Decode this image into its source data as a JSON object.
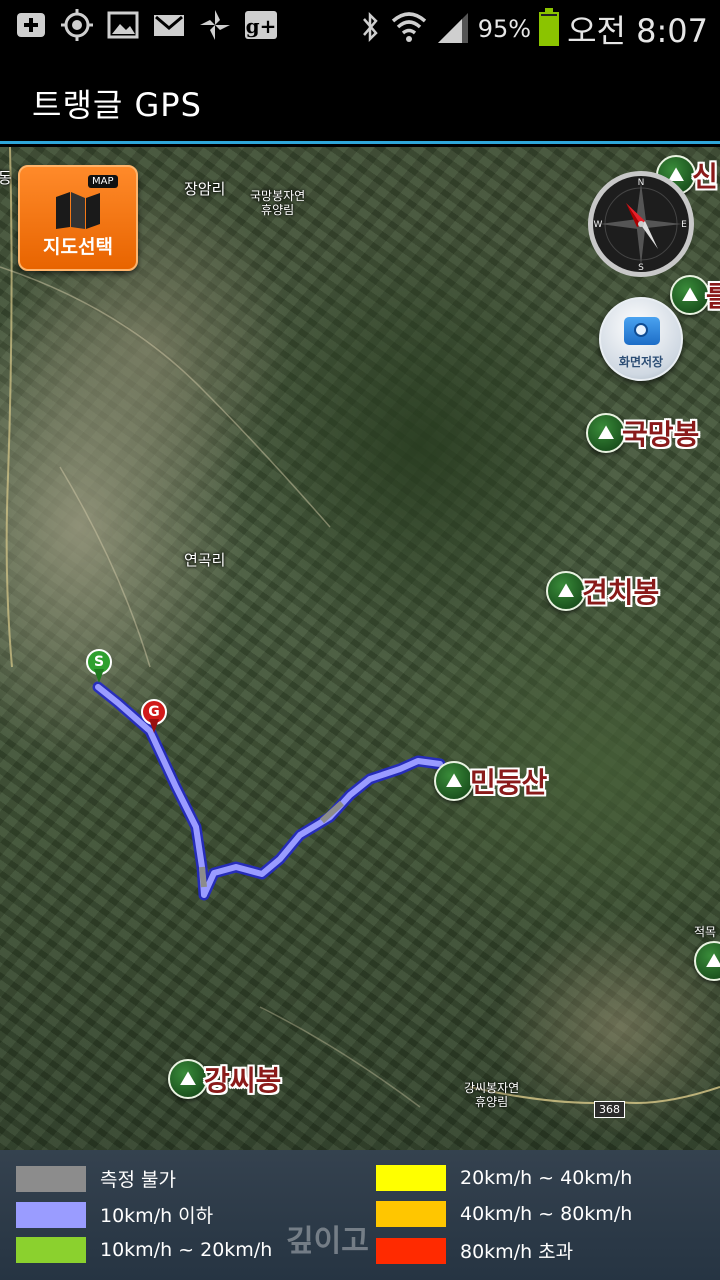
{
  "status_bar": {
    "icons": [
      "add-box-icon",
      "gps-icon",
      "picture-icon",
      "gmail-icon",
      "pinwheel-icon",
      "google-plus-icon"
    ],
    "battery_percent": "95%",
    "battery_level": 0.95,
    "time": "오전 8:07"
  },
  "app_bar": {
    "title": "트랭글 GPS"
  },
  "map": {
    "buttons": {
      "map_select": "지도선택",
      "map_badge": "MAP",
      "screenshot": "화면저장"
    },
    "compass": {
      "n": "N",
      "s": "S",
      "e": "E",
      "w": "W"
    },
    "place_labels": [
      {
        "name": "장암리"
      },
      {
        "name": "국망봉자연\n휴양림"
      },
      {
        "name": "연곡리"
      },
      {
        "name": "강씨봉자연\n휴양림"
      },
      {
        "name": "동"
      }
    ],
    "peaks": [
      {
        "name": "신"
      },
      {
        "name": "를"
      },
      {
        "name": "국망봉"
      },
      {
        "name": "견치봉"
      },
      {
        "name": "민둥산"
      },
      {
        "name": "강씨봉"
      },
      {
        "name": "적목"
      }
    ],
    "route": {
      "start_marker": "S",
      "goal_marker": "G"
    },
    "road_number": "368"
  },
  "legend": {
    "items": [
      {
        "label": "측정 불가",
        "color": "#8c8c8c"
      },
      {
        "label": "10km/h 이하",
        "color": "#9a9cff"
      },
      {
        "label": "10km/h ~ 20km/h",
        "color": "#8bd12e"
      },
      {
        "label": "20km/h ~ 40km/h",
        "color": "#ffff00"
      },
      {
        "label": "40km/h ~ 80km/h",
        "color": "#ffc600"
      },
      {
        "label": "80km/h 초과",
        "color": "#ff2a00"
      }
    ],
    "watermark": "깊이고"
  }
}
